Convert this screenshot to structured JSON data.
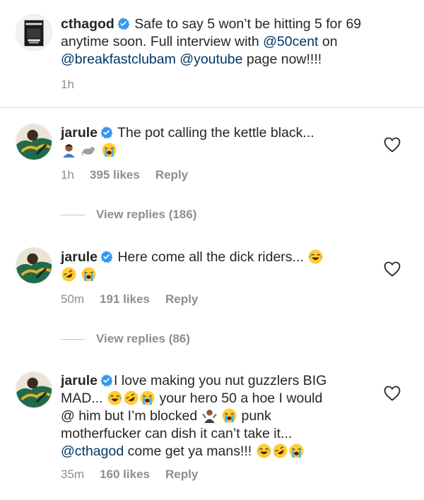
{
  "caption": {
    "username": "cthagod",
    "text_1": "Safe to say 5 won’t be hitting 5 for 69",
    "text_2": "anytime soon. Full interview with",
    "mention_1": "@50cent",
    "text_3": "on",
    "mention_2": "@breakfastclubam",
    "mention_3": "@youtube",
    "text_4": "page now!!!!",
    "time": "1h"
  },
  "comments": [
    {
      "username": "jarule",
      "text": "The pot calling the kettle black...",
      "time": "1h",
      "likes": "395 likes",
      "reply": "Reply",
      "view_replies": "View replies (186)"
    },
    {
      "username": "jarule",
      "text": "Here come all the dick riders...",
      "time": "50m",
      "likes": "191 likes",
      "reply": "Reply",
      "view_replies": "View replies (86)"
    },
    {
      "username": "jarule",
      "text_1": "I love making you nut guzzlers BIG",
      "text_2": "MAD...",
      "text_3": "your hero 50 a hoe I would",
      "text_4": "@ him but I’m blocked",
      "text_5": "punk",
      "text_6": "motherfucker can dish it can’t take it...",
      "mention": "@cthagod",
      "text_7": "come get ya mans!!!",
      "time": "35m",
      "likes": "160 likes",
      "reply": "Reply"
    }
  ],
  "icons": {
    "verified": "verified-badge-icon",
    "heart": "heart-outline-icon",
    "emoji": [
      "man-emoji",
      "rat-emoji",
      "loudly-crying-face-emoji",
      "face-with-tears-of-joy-emoji",
      "rolling-on-floor-laughing-emoji",
      "person-shrugging-emoji"
    ]
  },
  "colors": {
    "text": "#262626",
    "secondary": "#8e8e8e",
    "mention": "#00376b",
    "verified": "#3897f0",
    "divider": "#dbdbdb"
  }
}
